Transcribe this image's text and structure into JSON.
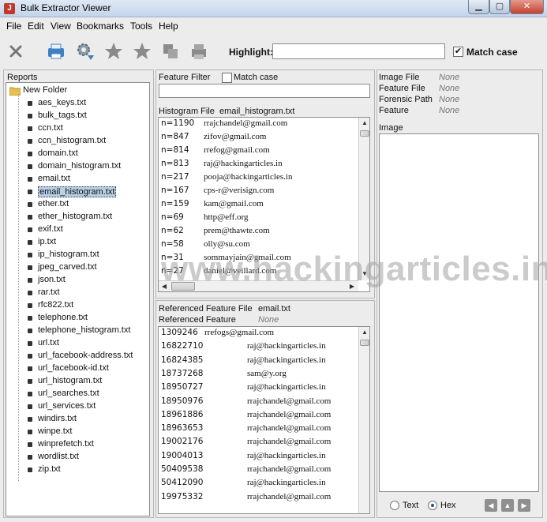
{
  "window": {
    "title": "Bulk Extractor Viewer"
  },
  "menu": [
    "File",
    "Edit",
    "View",
    "Bookmarks",
    "Tools",
    "Help"
  ],
  "toolbar": {
    "highlight_label": "Highlight:",
    "highlight_value": "",
    "match_case_label": "Match case",
    "match_case_checked": true
  },
  "reports": {
    "label": "Reports",
    "folder": "New Folder",
    "files": [
      "aes_keys.txt",
      "bulk_tags.txt",
      "ccn.txt",
      "ccn_histogram.txt",
      "domain.txt",
      "domain_histogram.txt",
      "email.txt",
      "email_histogram.txt",
      "ether.txt",
      "ether_histogram.txt",
      "exif.txt",
      "ip.txt",
      "ip_histogram.txt",
      "jpeg_carved.txt",
      "json.txt",
      "rar.txt",
      "rfc822.txt",
      "telephone.txt",
      "telephone_histogram.txt",
      "url.txt",
      "url_facebook-address.txt",
      "url_facebook-id.txt",
      "url_histogram.txt",
      "url_searches.txt",
      "url_services.txt",
      "windirs.txt",
      "winpe.txt",
      "winprefetch.txt",
      "wordlist.txt",
      "zip.txt"
    ],
    "selected": "email_histogram.txt"
  },
  "feature_filter": {
    "label": "Feature Filter",
    "match_case_label": "Match case",
    "value": ""
  },
  "histogram": {
    "label": "Histogram File",
    "file": "email_histogram.txt",
    "rows": [
      {
        "count": "n=1190",
        "email": "rrajchandel@gmail.com"
      },
      {
        "count": "n=847",
        "email": "zifov@gmail.com"
      },
      {
        "count": "n=814",
        "email": "rrefog@gmail.com"
      },
      {
        "count": "n=813",
        "email": "raj@hackingarticles.in"
      },
      {
        "count": "n=217",
        "email": "pooja@hackingarticles.in"
      },
      {
        "count": "n=167",
        "email": "cps-r@verisign.com"
      },
      {
        "count": "n=159",
        "email": "kam@gmail.com"
      },
      {
        "count": "n=69",
        "email": "http@eff.org"
      },
      {
        "count": "n=62",
        "email": "prem@thawte.com"
      },
      {
        "count": "n=58",
        "email": "olly@su.com"
      },
      {
        "count": "n=31",
        "email": "sommayjain@gmail.com"
      },
      {
        "count": "n=27",
        "email": "daniel@veillard.com"
      }
    ]
  },
  "referenced": {
    "file_label": "Referenced Feature File",
    "file": "email.txt",
    "feature_label": "Referenced Feature",
    "feature": "None",
    "rows": [
      {
        "offset": "1309246",
        "email": "rrefogs@gmail.com"
      },
      {
        "offset": "16822710",
        "email": "raj@hackingarticles.in"
      },
      {
        "offset": "16824385",
        "email": "raj@hackingarticles.in"
      },
      {
        "offset": "18737268",
        "email": "sam@y.org"
      },
      {
        "offset": "18950727",
        "email": "raj@hackingarticles.in"
      },
      {
        "offset": "18950976",
        "email": "rrajchandel@gmail.com"
      },
      {
        "offset": "18961886",
        "email": "rrajchandel@gmail.com"
      },
      {
        "offset": "18963653",
        "email": "rrajchandel@gmail.com"
      },
      {
        "offset": "19002176",
        "email": "rrajchandel@gmail.com"
      },
      {
        "offset": "19004013",
        "email": "raj@hackingarticles.in"
      },
      {
        "offset": "50409538",
        "email": "rrajchandel@gmail.com"
      },
      {
        "offset": "50412090",
        "email": "raj@hackingarticles.in"
      },
      {
        "offset": "19975332",
        "email": "rrajchandel@gmail.com"
      }
    ]
  },
  "image_info": {
    "image_file_label": "Image File",
    "image_file": "None",
    "feature_file_label": "Feature File",
    "feature_file": "None",
    "forensic_path_label": "Forensic Path",
    "forensic_path": "None",
    "feature_label": "Feature",
    "feature": "None",
    "image_label": "Image"
  },
  "view_mode": {
    "text_label": "Text",
    "hex_label": "Hex",
    "selected": "Hex"
  },
  "watermark": "www.hackingarticles.in"
}
